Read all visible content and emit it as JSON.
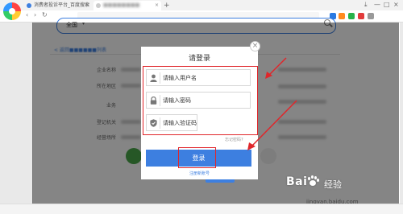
{
  "browser": {
    "tabs": [
      {
        "title": "消费者投诉平台_百度搜索"
      },
      {
        "title": "■■■■■■■■"
      }
    ],
    "new_tab": "+",
    "close_glyph": "×",
    "window_controls": [
      "⤓",
      "—",
      "□",
      "×"
    ],
    "nav": [
      "‹",
      "›",
      "↻"
    ]
  },
  "page": {
    "search_region": "全国",
    "breadcrumb": "< 返回■■■■■■列表",
    "field_labels": [
      "企业名称",
      "所在地区",
      "业务",
      "登记机关",
      "经营场所"
    ]
  },
  "login_modal": {
    "title": "请登录",
    "username_placeholder": "请输入用户名",
    "password_placeholder": "请输入密码",
    "captcha_placeholder": "请输入验证码",
    "forgot_password": "忘记密码?",
    "login_button": "登录",
    "register_link": "注册新账号",
    "close_glyph": "×"
  },
  "annotation_color": "#e0262b",
  "accent_color": "#3d7fe0",
  "watermark": {
    "brand": "Bai经验",
    "brand_latin": "Bai",
    "brand_cn": "经验",
    "url": "jingyan.baidu.com"
  }
}
